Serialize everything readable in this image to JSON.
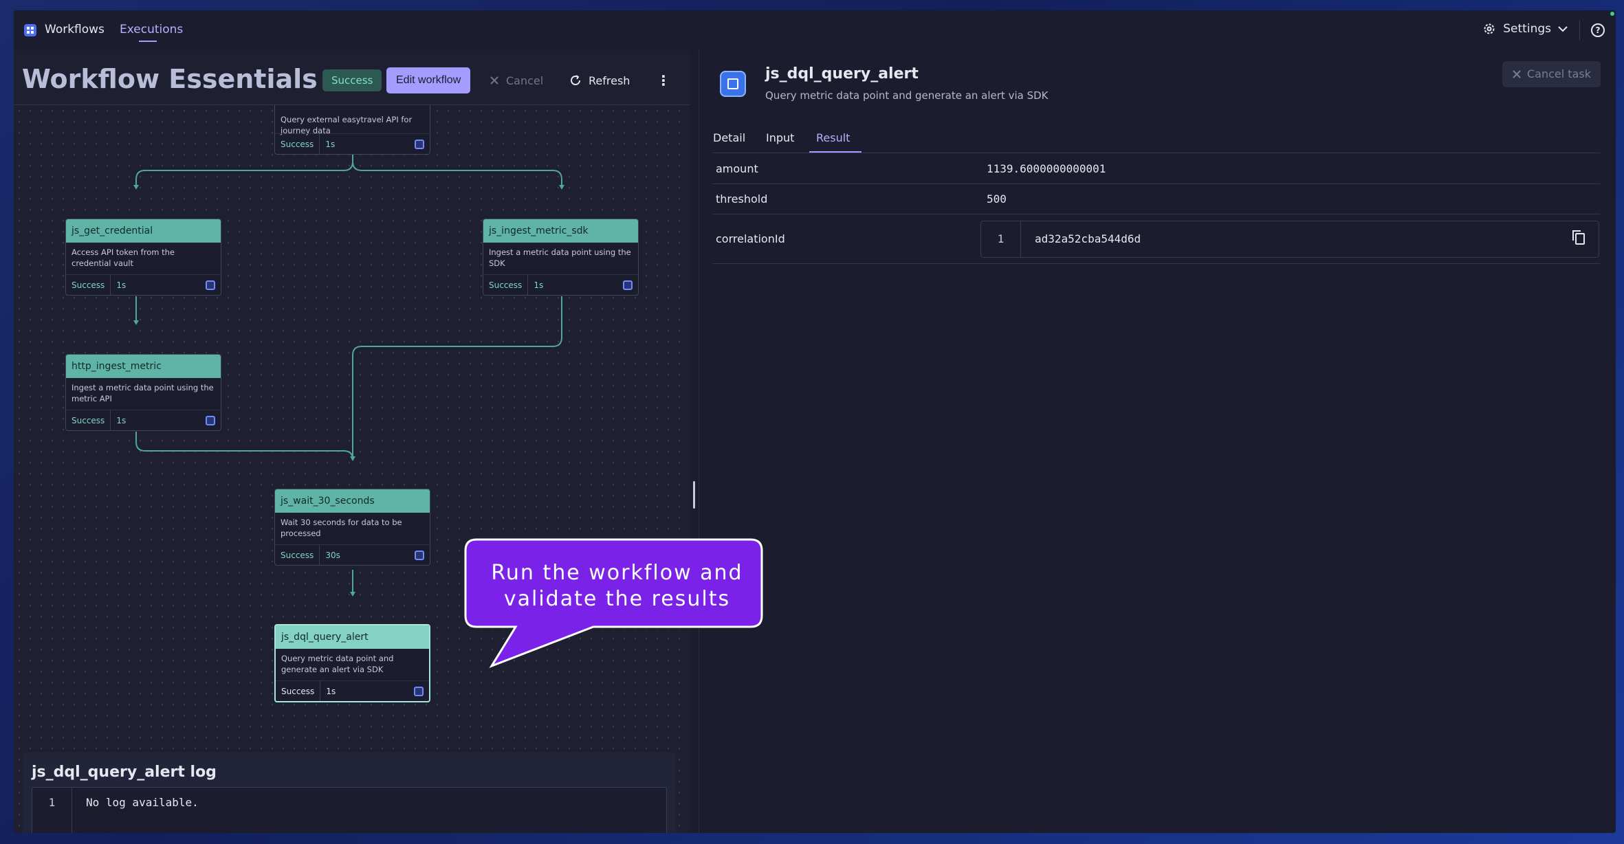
{
  "topbar": {
    "app_name": "Workflows",
    "nav_executions": "Executions",
    "settings_label": "Settings"
  },
  "workflow": {
    "title": "Workflow Essentials -...",
    "status": "Success",
    "edit_label": "Edit workflow",
    "cancel_label": "Cancel",
    "refresh_label": "Refresh"
  },
  "nodes": {
    "top": {
      "desc": "Query external easytravel API for journey data",
      "status": "Success",
      "duration": "1s"
    },
    "get_credential": {
      "name": "js_get_credential",
      "desc": "Access API token from the credential vault",
      "status": "Success",
      "duration": "1s"
    },
    "ingest_metric_sdk": {
      "name": "js_ingest_metric_sdk",
      "desc": "Ingest a metric data point using the SDK",
      "status": "Success",
      "duration": "1s"
    },
    "http_ingest_metric": {
      "name": "http_ingest_metric",
      "desc": "Ingest a metric data point using the metric API",
      "status": "Success",
      "duration": "1s"
    },
    "wait_30": {
      "name": "js_wait_30_seconds",
      "desc": "Wait 30 seconds for data to be processed",
      "status": "Success",
      "duration": "30s"
    },
    "dql_query_alert": {
      "name": "js_dql_query_alert",
      "desc": "Query metric data point and generate an alert via SDK",
      "status": "Success",
      "duration": "1s"
    }
  },
  "log": {
    "title": "js_dql_query_alert log",
    "line_no": "1",
    "text": "No log available."
  },
  "task": {
    "title": "js_dql_query_alert",
    "subtitle": "Query metric data point and generate an alert via SDK",
    "cancel_task_label": "Cancel task"
  },
  "tabs": {
    "detail": "Detail",
    "input": "Input",
    "result": "Result"
  },
  "result": {
    "amount_key": "amount",
    "amount_val": "1139.6000000000001",
    "threshold_key": "threshold",
    "threshold_val": "500",
    "corr_key": "correlationId",
    "corr_line": "1",
    "corr_val": "ad32a52cba544d6d"
  },
  "callout": {
    "line1": "Run the workflow and",
    "line2": "validate the results"
  }
}
